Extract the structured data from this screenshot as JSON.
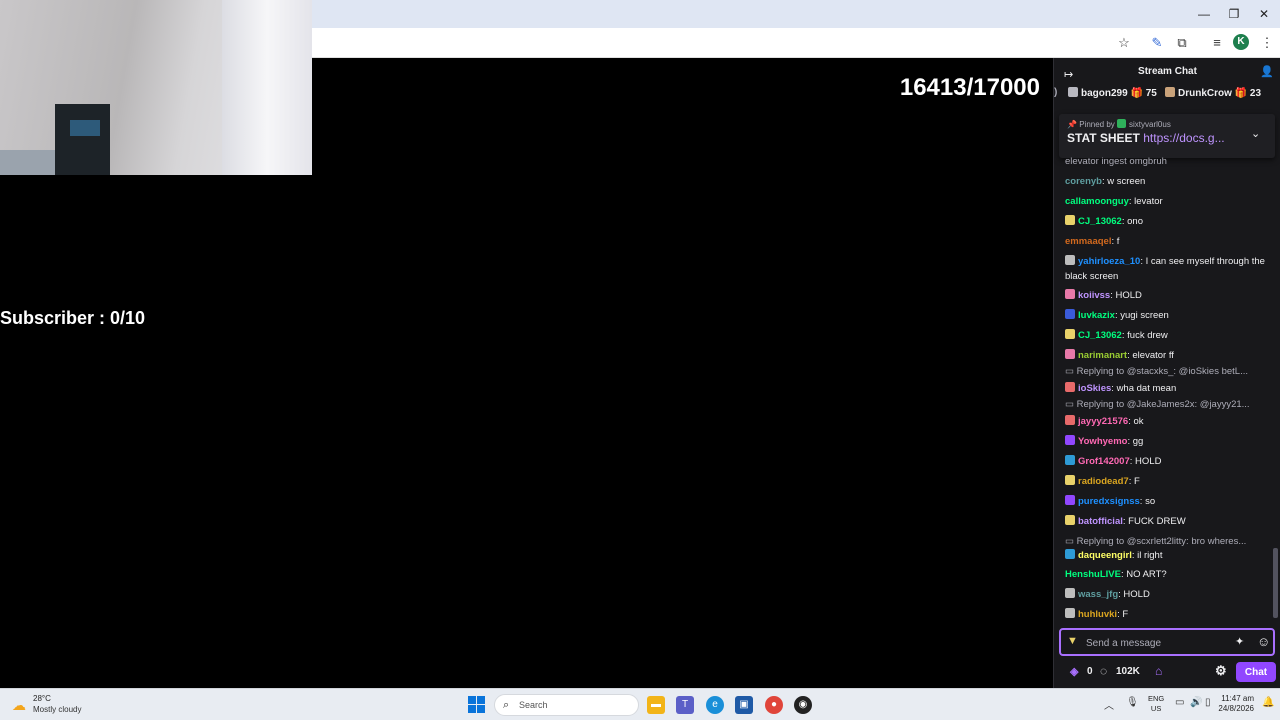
{
  "browser": {
    "window_controls": {
      "minimize": "—",
      "restore": "❐",
      "close": "✕"
    },
    "profile_initial": "K"
  },
  "stream": {
    "counter": "16413/17000",
    "subscriber": "Subscriber : 0/10"
  },
  "chat": {
    "title": "Stream Chat",
    "leaderboard": [
      {
        "user": "bagon299",
        "count": "75"
      },
      {
        "user": "DrunkCrow",
        "count": "23"
      }
    ],
    "pinned": {
      "by_label": "Pinned by",
      "by_user": "sixtyvarl0us",
      "text": "STAT SHEET",
      "link": "https://docs.g..."
    },
    "messages": [
      {
        "user": "",
        "text": "elevator ingest omgbruh",
        "color": "#adadb8"
      },
      {
        "user": "corenyb",
        "text": "w screen",
        "color": "#5f9ea0"
      },
      {
        "user": "callamoonguy",
        "text": "levator",
        "color": "#00ff7f"
      },
      {
        "user": "CJ_13062",
        "text": "ono",
        "color": "#00ff7f",
        "badge": "#e9d26a"
      },
      {
        "user": "emmaaqel",
        "text": "f",
        "color": "#d2691e"
      },
      {
        "user": "yahirloeza_10",
        "text": "I can see myself through the black screen",
        "color": "#1e90ff",
        "badge": "#bdbdbd"
      },
      {
        "user": "koiivss",
        "text": "HOLD",
        "color": "#bf94ff",
        "badge": "#e879a8"
      },
      {
        "user": "luvkazix",
        "text": "yugi screen",
        "color": "#00ff7f",
        "badge": "#3a5bd9"
      },
      {
        "user": "CJ_13062",
        "text": "fuck drew",
        "color": "#00ff7f",
        "badge": "#e9d26a"
      },
      {
        "user": "narimanart",
        "text": "elevator ff",
        "color": "#9acd32",
        "badge": "#e879a8"
      },
      {
        "reply": "Replying to @stacxks_: @ioSkies betL..."
      },
      {
        "user": "ioSkies",
        "text": "wha dat mean",
        "color": "#bf94ff",
        "badge": "#e86a6a"
      },
      {
        "reply": "Replying to @JakeJames2x: @jayyy21..."
      },
      {
        "user": "jayyy21576",
        "text": "ok",
        "color": "#ff69b4",
        "badge": "#e86a6a"
      },
      {
        "user": "Yowhyemo",
        "text": "gg",
        "color": "#ff69b4",
        "badge": "#9147ff"
      },
      {
        "user": "Grof142007",
        "text": "HOLD",
        "color": "#ff69b4",
        "badge": "#2e9bd6"
      },
      {
        "user": "radiodead7",
        "text": "F",
        "color": "#daa520",
        "badge": "#e9d26a"
      },
      {
        "user": "puredxsignss",
        "text": "so",
        "color": "#1e90ff",
        "badge": "#9147ff"
      },
      {
        "user": "batofficial",
        "text": "FUCK DREW",
        "color": "#bf94ff",
        "badge": "#e9d26a"
      },
      {
        "reply": "Replying to @scxrlett2litty: bro wheres..."
      },
      {
        "user": "daqueengirl",
        "text": "il right",
        "color": "#ffff66",
        "badge": "#2e9bd6"
      },
      {
        "user": "HenshuLIVE",
        "text": "NO ART?",
        "color": "#00ff7f"
      },
      {
        "user": "wass_jfg",
        "text": "HOLD",
        "color": "#5f9ea0",
        "badge": "#bdbdbd"
      },
      {
        "user": "huhluvki",
        "text": "F",
        "color": "#daa520",
        "badge": "#bdbdbd"
      }
    ],
    "input_placeholder": "Send a message",
    "bits": "0",
    "points": "102K",
    "chat_button": "Chat"
  },
  "taskbar": {
    "temperature": "28°C",
    "weather": "Mostly cloudy",
    "search_label": "Search",
    "lang_top": "ENG",
    "lang_bottom": "US",
    "time": "11:47 am",
    "date": "24/8/2026"
  },
  "colors": {
    "chat_bg": "#18181b",
    "accent": "#9147ff",
    "link": "#bf94ff"
  }
}
